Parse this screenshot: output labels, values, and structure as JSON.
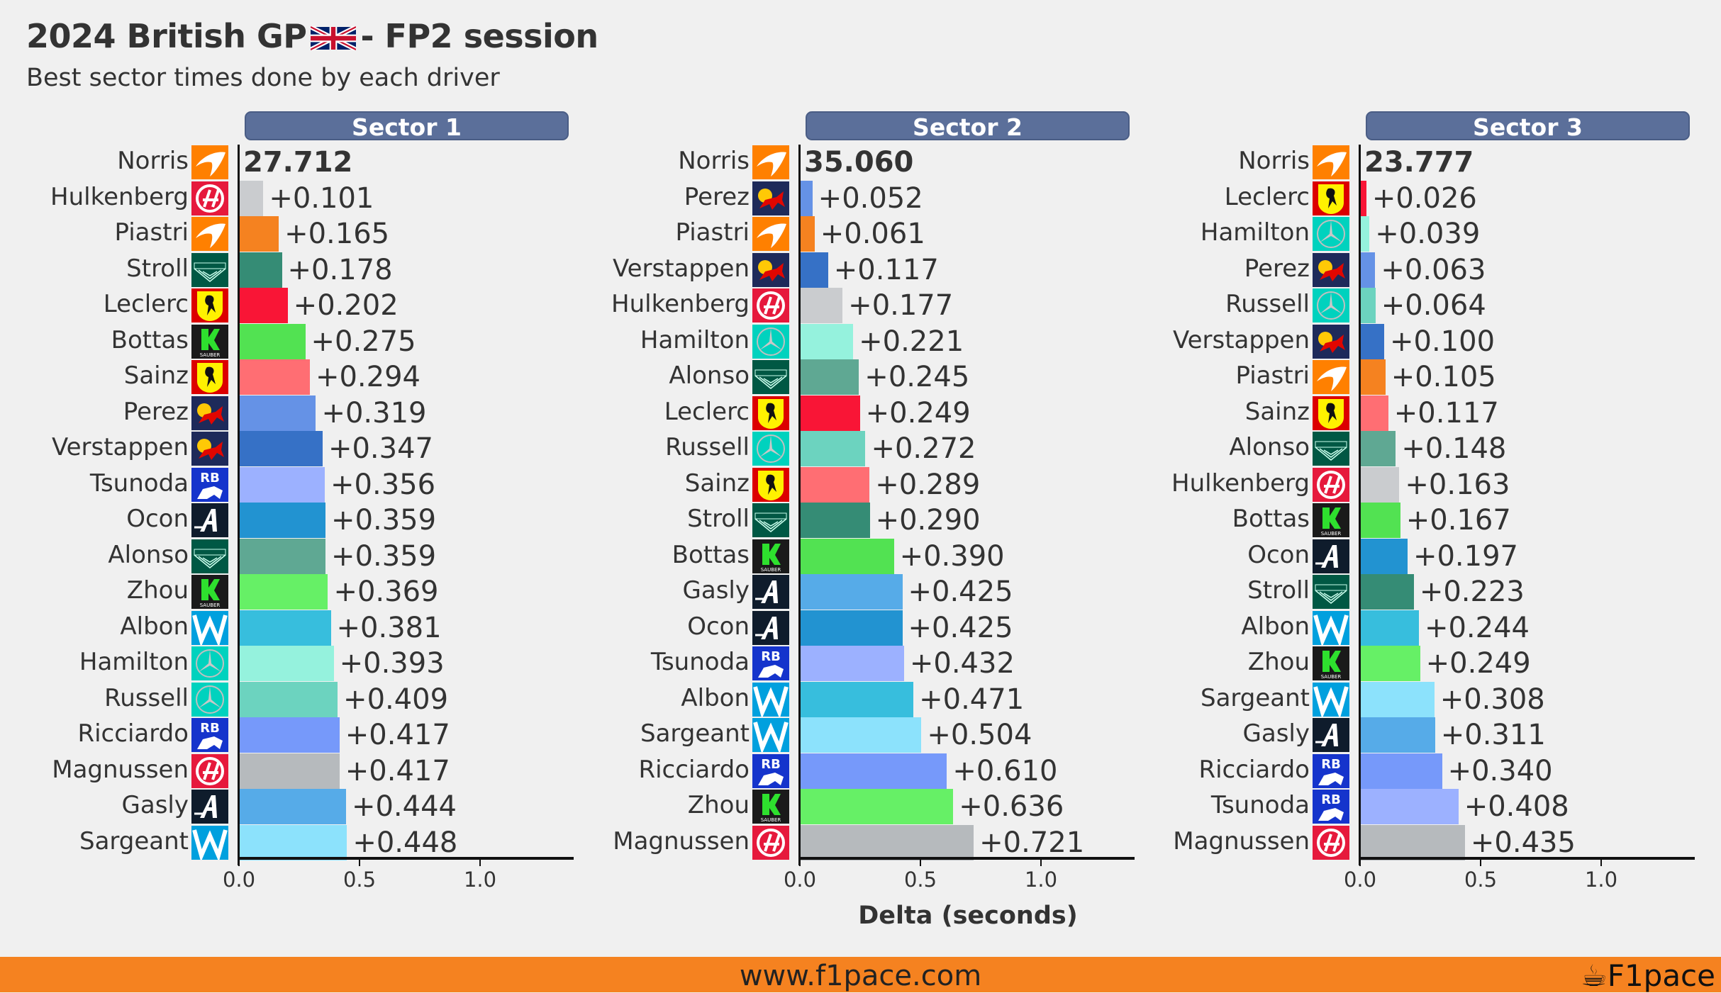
{
  "header": {
    "title_pre": "2024 British GP",
    "title_post": "- FP2 session",
    "flag_icon": "uk-flag-icon",
    "subtitle": "Best sector times done by each driver"
  },
  "footer": {
    "url": "www.f1pace.com",
    "brand": "F1pace",
    "color": "#f58220"
  },
  "team_colors": {
    "McLaren": "#f58220",
    "Haas": "#cacccf",
    "Aston Martin": "#358c75",
    "Ferrari": "#f91536",
    "Sauber": "#52e252",
    "Red Bull": "#3671c6",
    "RB": "#9cb1ff",
    "Alpine": "#2293d1",
    "Williams": "#37bedd",
    "Mercedes": "#6cd3bf"
  },
  "chart_data": [
    {
      "type": "bar",
      "orientation": "horizontal",
      "title": "Sector 1",
      "xlabel": "Delta (seconds)",
      "xlim": [
        0,
        1.39
      ],
      "xticks": [
        "0.0",
        "0.5",
        "1.0"
      ],
      "xtick_values": [
        0,
        0.5,
        1.0
      ],
      "best_time_label": "27.712",
      "rows": [
        {
          "driver": "Norris",
          "team": "McLaren",
          "delta": 0,
          "label": "27.712",
          "color": "#f58220"
        },
        {
          "driver": "Hulkenberg",
          "team": "Haas",
          "delta": 0.101,
          "label": "+0.101",
          "color": "#cacccf"
        },
        {
          "driver": "Piastri",
          "team": "McLaren",
          "delta": 0.165,
          "label": "+0.165",
          "color": "#f58220"
        },
        {
          "driver": "Stroll",
          "team": "Aston Martin",
          "delta": 0.178,
          "label": "+0.178",
          "color": "#358c75"
        },
        {
          "driver": "Leclerc",
          "team": "Ferrari",
          "delta": 0.202,
          "label": "+0.202",
          "color": "#f91536"
        },
        {
          "driver": "Bottas",
          "team": "Sauber",
          "delta": 0.275,
          "label": "+0.275",
          "color": "#52e252"
        },
        {
          "driver": "Sainz",
          "team": "Ferrari",
          "delta": 0.294,
          "label": "+0.294",
          "color": "#ff6e73"
        },
        {
          "driver": "Perez",
          "team": "Red Bull",
          "delta": 0.319,
          "label": "+0.319",
          "color": "#6592e6"
        },
        {
          "driver": "Verstappen",
          "team": "Red Bull",
          "delta": 0.347,
          "label": "+0.347",
          "color": "#3671c6"
        },
        {
          "driver": "Tsunoda",
          "team": "RB",
          "delta": 0.356,
          "label": "+0.356",
          "color": "#9cb1ff"
        },
        {
          "driver": "Ocon",
          "team": "Alpine",
          "delta": 0.359,
          "label": "+0.359",
          "color": "#2293d1"
        },
        {
          "driver": "Alonso",
          "team": "Aston Martin",
          "delta": 0.359,
          "label": "+0.359",
          "color": "#5fa893"
        },
        {
          "driver": "Zhou",
          "team": "Sauber",
          "delta": 0.369,
          "label": "+0.369",
          "color": "#66f066"
        },
        {
          "driver": "Albon",
          "team": "Williams",
          "delta": 0.381,
          "label": "+0.381",
          "color": "#37bedd"
        },
        {
          "driver": "Hamilton",
          "team": "Mercedes",
          "delta": 0.393,
          "label": "+0.393",
          "color": "#95f2dd"
        },
        {
          "driver": "Russell",
          "team": "Mercedes",
          "delta": 0.409,
          "label": "+0.409",
          "color": "#6cd3bf"
        },
        {
          "driver": "Ricciardo",
          "team": "RB",
          "delta": 0.417,
          "label": "+0.417",
          "color": "#7699fa"
        },
        {
          "driver": "Magnussen",
          "team": "Haas",
          "delta": 0.417,
          "label": "+0.417",
          "color": "#b6babd"
        },
        {
          "driver": "Gasly",
          "team": "Alpine",
          "delta": 0.444,
          "label": "+0.444",
          "color": "#56abe8"
        },
        {
          "driver": "Sargeant",
          "team": "Williams",
          "delta": 0.448,
          "label": "+0.448",
          "color": "#8ce2fc"
        }
      ]
    },
    {
      "type": "bar",
      "orientation": "horizontal",
      "title": "Sector 2",
      "xlabel": "Delta (seconds)",
      "xlim": [
        0,
        1.39
      ],
      "xticks": [
        "0.0",
        "0.5",
        "1.0"
      ],
      "xtick_values": [
        0,
        0.5,
        1.0
      ],
      "best_time_label": "35.060",
      "rows": [
        {
          "driver": "Norris",
          "team": "McLaren",
          "delta": 0,
          "label": "35.060",
          "color": "#f58220"
        },
        {
          "driver": "Perez",
          "team": "Red Bull",
          "delta": 0.052,
          "label": "+0.052",
          "color": "#6592e6"
        },
        {
          "driver": "Piastri",
          "team": "McLaren",
          "delta": 0.061,
          "label": "+0.061",
          "color": "#f58220"
        },
        {
          "driver": "Verstappen",
          "team": "Red Bull",
          "delta": 0.117,
          "label": "+0.117",
          "color": "#3671c6"
        },
        {
          "driver": "Hulkenberg",
          "team": "Haas",
          "delta": 0.177,
          "label": "+0.177",
          "color": "#cacccf"
        },
        {
          "driver": "Hamilton",
          "team": "Mercedes",
          "delta": 0.221,
          "label": "+0.221",
          "color": "#95f2dd"
        },
        {
          "driver": "Alonso",
          "team": "Aston Martin",
          "delta": 0.245,
          "label": "+0.245",
          "color": "#5fa893"
        },
        {
          "driver": "Leclerc",
          "team": "Ferrari",
          "delta": 0.249,
          "label": "+0.249",
          "color": "#f91536"
        },
        {
          "driver": "Russell",
          "team": "Mercedes",
          "delta": 0.272,
          "label": "+0.272",
          "color": "#6cd3bf"
        },
        {
          "driver": "Sainz",
          "team": "Ferrari",
          "delta": 0.289,
          "label": "+0.289",
          "color": "#ff6e73"
        },
        {
          "driver": "Stroll",
          "team": "Aston Martin",
          "delta": 0.29,
          "label": "+0.290",
          "color": "#358c75"
        },
        {
          "driver": "Bottas",
          "team": "Sauber",
          "delta": 0.39,
          "label": "+0.390",
          "color": "#52e252"
        },
        {
          "driver": "Gasly",
          "team": "Alpine",
          "delta": 0.425,
          "label": "+0.425",
          "color": "#56abe8"
        },
        {
          "driver": "Ocon",
          "team": "Alpine",
          "delta": 0.425,
          "label": "+0.425",
          "color": "#2293d1"
        },
        {
          "driver": "Tsunoda",
          "team": "RB",
          "delta": 0.432,
          "label": "+0.432",
          "color": "#9cb1ff"
        },
        {
          "driver": "Albon",
          "team": "Williams",
          "delta": 0.471,
          "label": "+0.471",
          "color": "#37bedd"
        },
        {
          "driver": "Sargeant",
          "team": "Williams",
          "delta": 0.504,
          "label": "+0.504",
          "color": "#8ce2fc"
        },
        {
          "driver": "Ricciardo",
          "team": "RB",
          "delta": 0.61,
          "label": "+0.610",
          "color": "#7699fa"
        },
        {
          "driver": "Zhou",
          "team": "Sauber",
          "delta": 0.636,
          "label": "+0.636",
          "color": "#66f066"
        },
        {
          "driver": "Magnussen",
          "team": "Haas",
          "delta": 0.721,
          "label": "+0.721",
          "color": "#b6babd"
        }
      ]
    },
    {
      "type": "bar",
      "orientation": "horizontal",
      "title": "Sector 3",
      "xlabel": "Delta (seconds)",
      "xlim": [
        0,
        1.39
      ],
      "xticks": [
        "0.0",
        "0.5",
        "1.0"
      ],
      "xtick_values": [
        0,
        0.5,
        1.0
      ],
      "best_time_label": "23.777",
      "rows": [
        {
          "driver": "Norris",
          "team": "McLaren",
          "delta": 0,
          "label": "23.777",
          "color": "#f58220"
        },
        {
          "driver": "Leclerc",
          "team": "Ferrari",
          "delta": 0.026,
          "label": "+0.026",
          "color": "#f91536"
        },
        {
          "driver": "Hamilton",
          "team": "Mercedes",
          "delta": 0.039,
          "label": "+0.039",
          "color": "#95f2dd"
        },
        {
          "driver": "Perez",
          "team": "Red Bull",
          "delta": 0.063,
          "label": "+0.063",
          "color": "#6592e6"
        },
        {
          "driver": "Russell",
          "team": "Mercedes",
          "delta": 0.064,
          "label": "+0.064",
          "color": "#6cd3bf"
        },
        {
          "driver": "Verstappen",
          "team": "Red Bull",
          "delta": 0.1,
          "label": "+0.100",
          "color": "#3671c6"
        },
        {
          "driver": "Piastri",
          "team": "McLaren",
          "delta": 0.105,
          "label": "+0.105",
          "color": "#f58220"
        },
        {
          "driver": "Sainz",
          "team": "Ferrari",
          "delta": 0.117,
          "label": "+0.117",
          "color": "#ff6e73"
        },
        {
          "driver": "Alonso",
          "team": "Aston Martin",
          "delta": 0.148,
          "label": "+0.148",
          "color": "#5fa893"
        },
        {
          "driver": "Hulkenberg",
          "team": "Haas",
          "delta": 0.163,
          "label": "+0.163",
          "color": "#cacccf"
        },
        {
          "driver": "Bottas",
          "team": "Sauber",
          "delta": 0.167,
          "label": "+0.167",
          "color": "#52e252"
        },
        {
          "driver": "Ocon",
          "team": "Alpine",
          "delta": 0.197,
          "label": "+0.197",
          "color": "#2293d1"
        },
        {
          "driver": "Stroll",
          "team": "Aston Martin",
          "delta": 0.223,
          "label": "+0.223",
          "color": "#358c75"
        },
        {
          "driver": "Albon",
          "team": "Williams",
          "delta": 0.244,
          "label": "+0.244",
          "color": "#37bedd"
        },
        {
          "driver": "Zhou",
          "team": "Sauber",
          "delta": 0.249,
          "label": "+0.249",
          "color": "#66f066"
        },
        {
          "driver": "Sargeant",
          "team": "Williams",
          "delta": 0.308,
          "label": "+0.308",
          "color": "#8ce2fc"
        },
        {
          "driver": "Gasly",
          "team": "Alpine",
          "delta": 0.311,
          "label": "+0.311",
          "color": "#56abe8"
        },
        {
          "driver": "Ricciardo",
          "team": "RB",
          "delta": 0.34,
          "label": "+0.340",
          "color": "#7699fa"
        },
        {
          "driver": "Tsunoda",
          "team": "RB",
          "delta": 0.408,
          "label": "+0.408",
          "color": "#9cb1ff"
        },
        {
          "driver": "Magnussen",
          "team": "Haas",
          "delta": 0.435,
          "label": "+0.435",
          "color": "#b6babd"
        }
      ]
    }
  ]
}
